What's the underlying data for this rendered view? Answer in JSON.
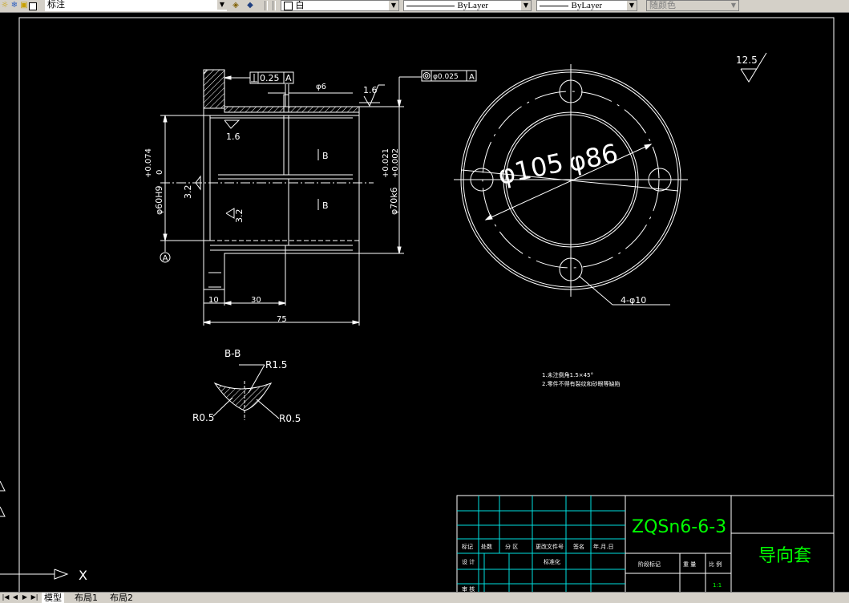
{
  "toolbar": {
    "layer_name": "标注",
    "color_value": "白",
    "linetype_value": "ByLayer",
    "lineweight_value": "ByLayer",
    "plotstyle_value": "随颜色"
  },
  "drawing": {
    "tol_flat": "0.25",
    "tol_flat_ref": "A",
    "tol_coax": "φ0.025",
    "tol_coax_ref": "A",
    "dim_phi6": "φ6",
    "rough_16_top": "1.6",
    "rough_16_inner": "1.6",
    "rough_32_left": "3.2",
    "rough_32_inner": "3.2",
    "rough_125": "12.5",
    "dim_inner": "φ60H9",
    "dim_inner_tol_upper": "+0.074",
    "dim_inner_tol_lower": "0",
    "dim_outer": "φ70k6",
    "dim_outer_tol_upper": "+0.021",
    "dim_outer_tol_lower": "+0.002",
    "datum_label": "A",
    "section_mark_1": "B",
    "section_mark_2": "B",
    "dim_10": "10",
    "dim_30": "30",
    "dim_75": "75",
    "dim_phi105": "φ105",
    "dim_phi86": "φ86",
    "dim_holes": "4-φ10",
    "section_title": "B-B",
    "r15": "R1.5",
    "r05_left": "R0.5",
    "r05_right": "R0.5",
    "note_1": "1.未注倒角1.5×45°",
    "note_2": "2.零件不得有裂纹和砂眼等缺陷",
    "material": "ZQSn6-6-3",
    "part_name": "导向套",
    "scale": "1:1",
    "tb_labels": [
      "标记",
      "处数",
      "分 区",
      "更改文件号",
      "签名",
      "年.月.日"
    ],
    "tb_design": "设 计",
    "tb_standard": "标准化",
    "tb_stage": "阶段标记",
    "tb_weight": "重 量",
    "tb_scale_label": "比 例",
    "tb_review": "审 核",
    "ucs_x": "X"
  },
  "tabs": {
    "model": "模型",
    "layout1": "布局1",
    "layout2": "布局2"
  }
}
